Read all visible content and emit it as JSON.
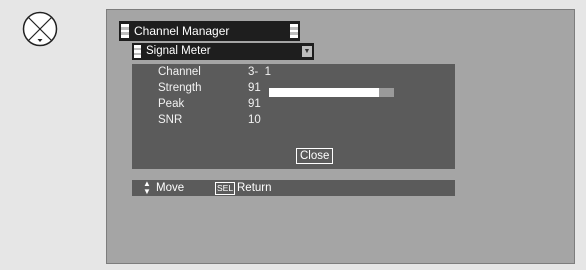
{
  "window": {
    "title": "Channel Manager"
  },
  "submenu": {
    "title": "Signal Meter"
  },
  "signal": {
    "channel_label": "Channel",
    "channel_value": "3-  1",
    "strength_label": "Strength",
    "strength_value": "91",
    "strength_fraction": 0.88,
    "peak_label": "Peak",
    "peak_value": "91",
    "snr_label": "SNR",
    "snr_value": "10"
  },
  "buttons": {
    "close": "Close"
  },
  "help": {
    "move_label": "Move",
    "sel_key": "SEL",
    "return_label": "Return"
  },
  "icons": {
    "remote": "remote-dpad-icon",
    "move": "up-down-arrows-icon",
    "dropdown": "dropdown-arrow-icon"
  },
  "colors": {
    "background": "#e6e6e6",
    "screen": "#a5a5a5",
    "panel": "#5b5b5b",
    "title_bar": "#1e1e1e",
    "bar_fill": "#ffffff",
    "bar_track": "#9a9a9a"
  }
}
